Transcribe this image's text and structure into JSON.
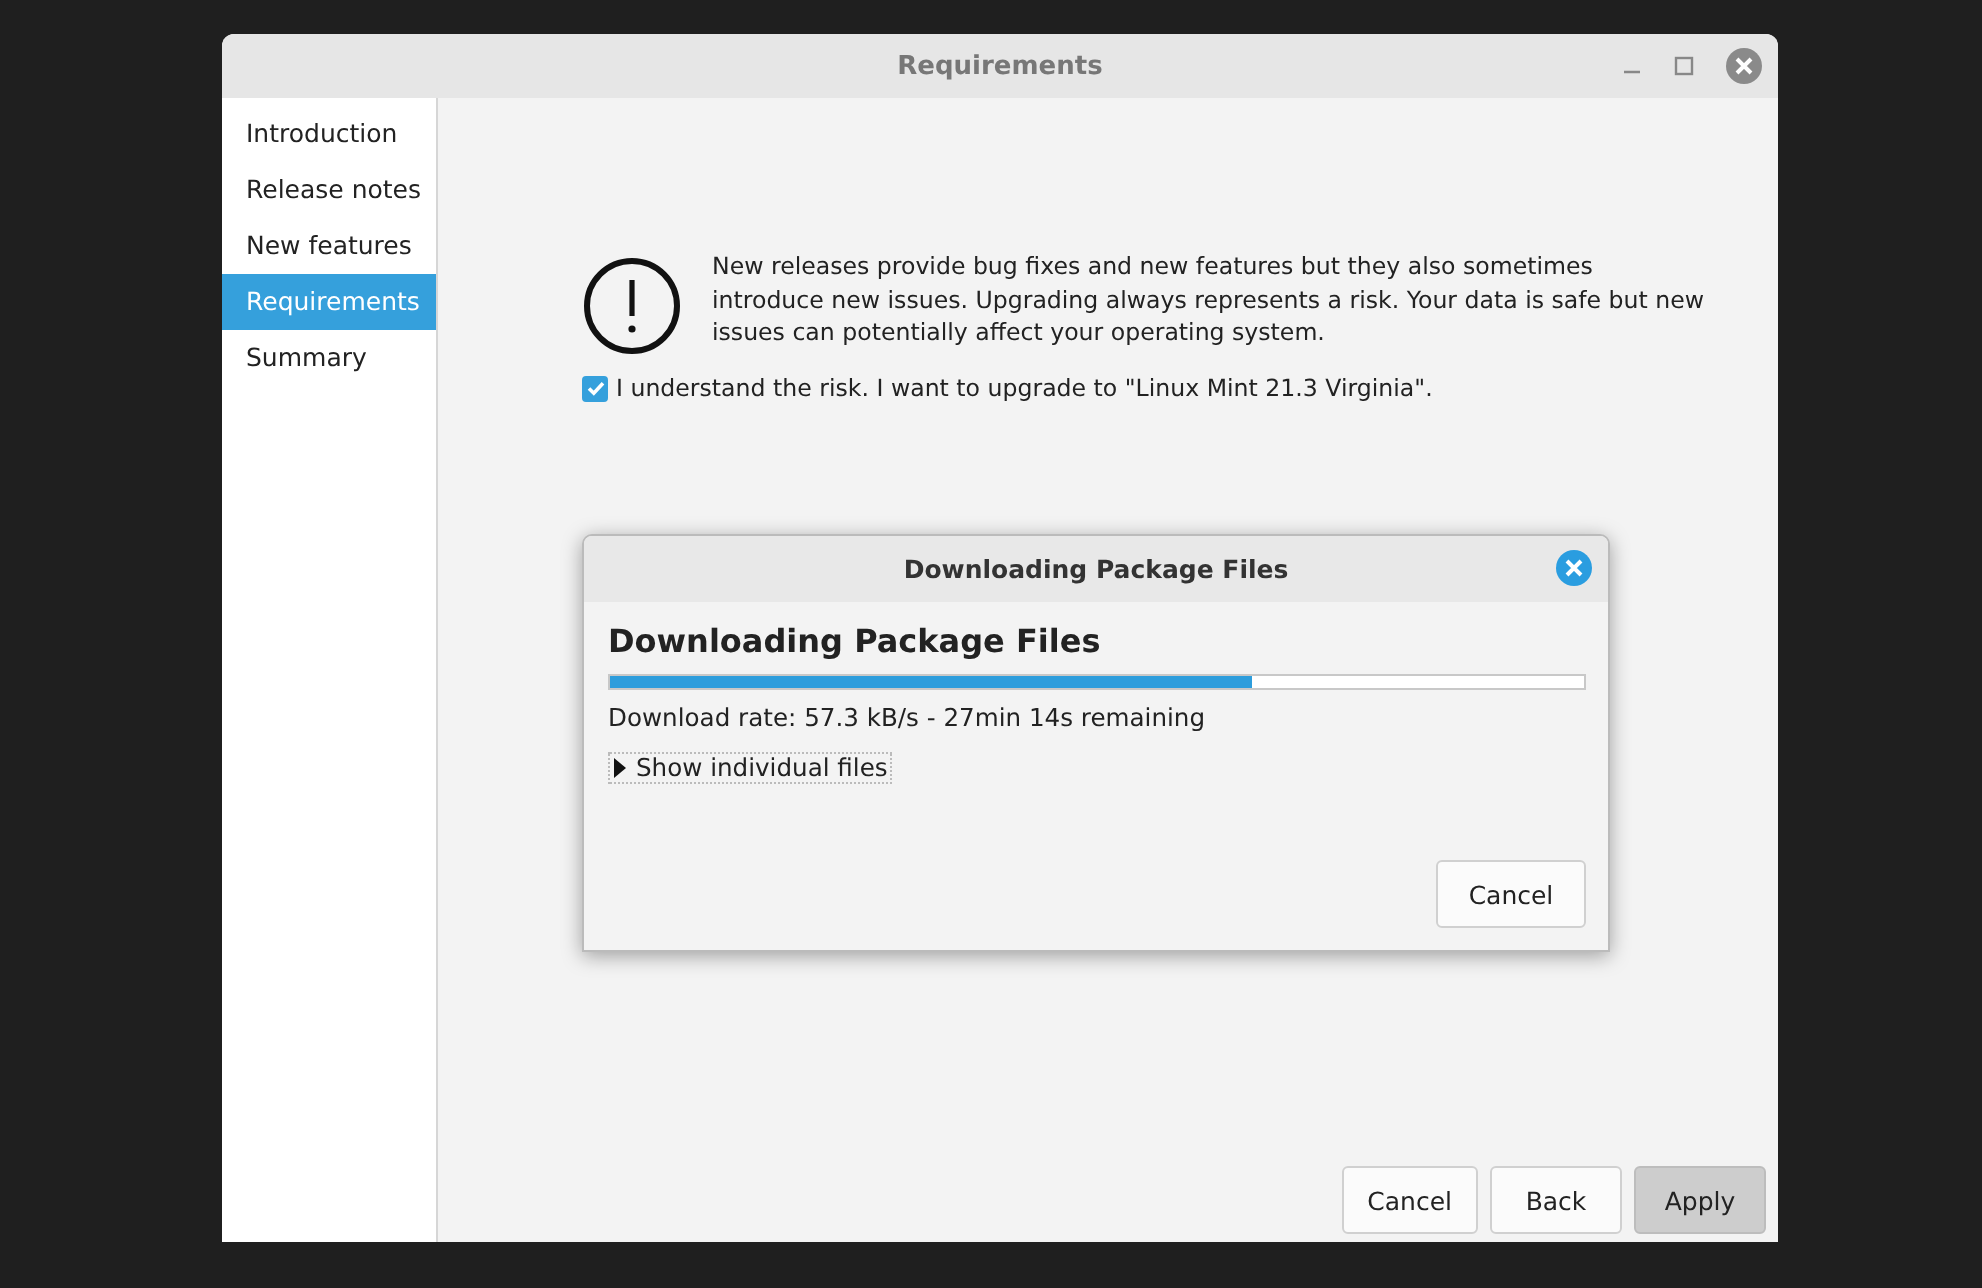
{
  "window": {
    "title": "Requirements"
  },
  "sidebar": {
    "items": [
      {
        "label": "Introduction",
        "selected": false
      },
      {
        "label": "Release notes",
        "selected": false
      },
      {
        "label": "New features",
        "selected": false
      },
      {
        "label": "Requirements",
        "selected": true
      },
      {
        "label": "Summary",
        "selected": false
      }
    ]
  },
  "warning": {
    "text": "New releases provide bug fixes and new features but they also sometimes introduce new issues. Upgrading always represents a risk. Your data is safe but new issues can potentially affect your operating system."
  },
  "consent": {
    "label": "I understand the risk. I want to upgrade to \"Linux Mint 21.3 Virginia\".",
    "checked": true
  },
  "dialog": {
    "title": "Downloading Package Files",
    "heading": "Downloading Package Files",
    "progress": {
      "level": 0.66
    },
    "status": "Download rate: 57.3 kB/s - 27min 14s remaining",
    "expander": {
      "label": "Show individual files",
      "expanded": false
    },
    "buttons": [
      {
        "label": "Cancel"
      }
    ]
  },
  "buttons": [
    {
      "label": "Cancel",
      "kind": "normal"
    },
    {
      "label": "Back",
      "kind": "normal"
    },
    {
      "label": "Apply",
      "kind": "suggested"
    }
  ]
}
